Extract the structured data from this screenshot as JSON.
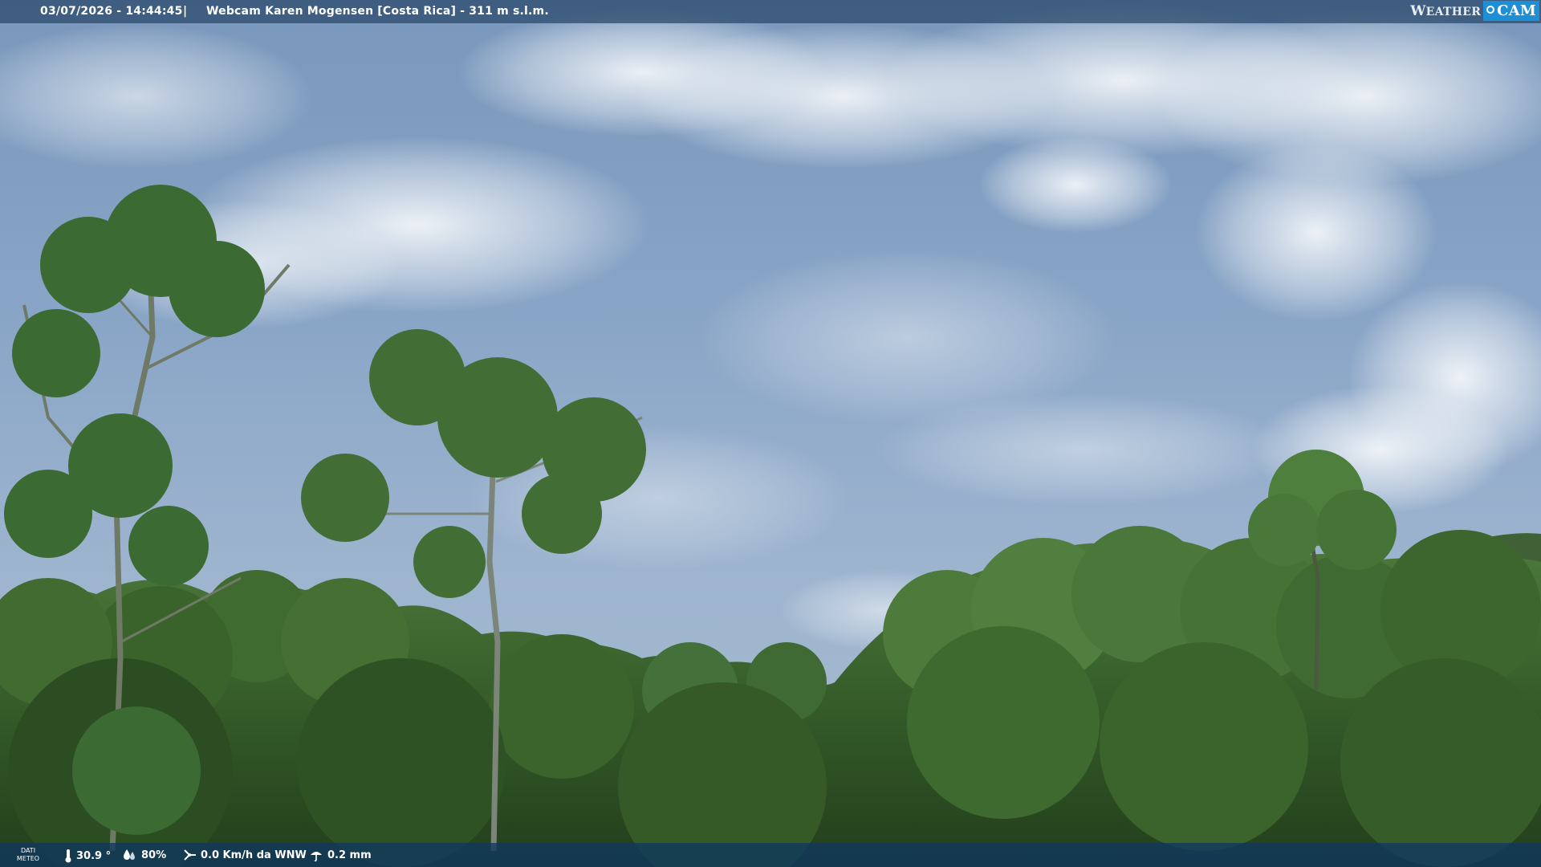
{
  "header": {
    "datetime": "03/07/2026 - 14:44:45",
    "separator": "|",
    "title": "Webcam Karen Mogensen [Costa Rica] - 311 m s.l.m.",
    "logo": {
      "weather_initial": "W",
      "weather_rest": "EATHER",
      "cam": "CAM"
    }
  },
  "footer": {
    "label_line1": "DATI",
    "label_line2": "METEO",
    "temperature": "30.9 °",
    "humidity": "80%",
    "wind": "0.0 Km/h da WNW",
    "rain": "0.2 mm",
    "icons": [
      "thermometer-icon",
      "humidity-icon",
      "wind-icon",
      "rain-icon"
    ]
  },
  "colors": {
    "topbar": "#284669",
    "bottombar": "#0f375f",
    "logo_accent": "#1d8fd6",
    "sky": "#7f9cbf",
    "foliage": "#355a2a"
  }
}
